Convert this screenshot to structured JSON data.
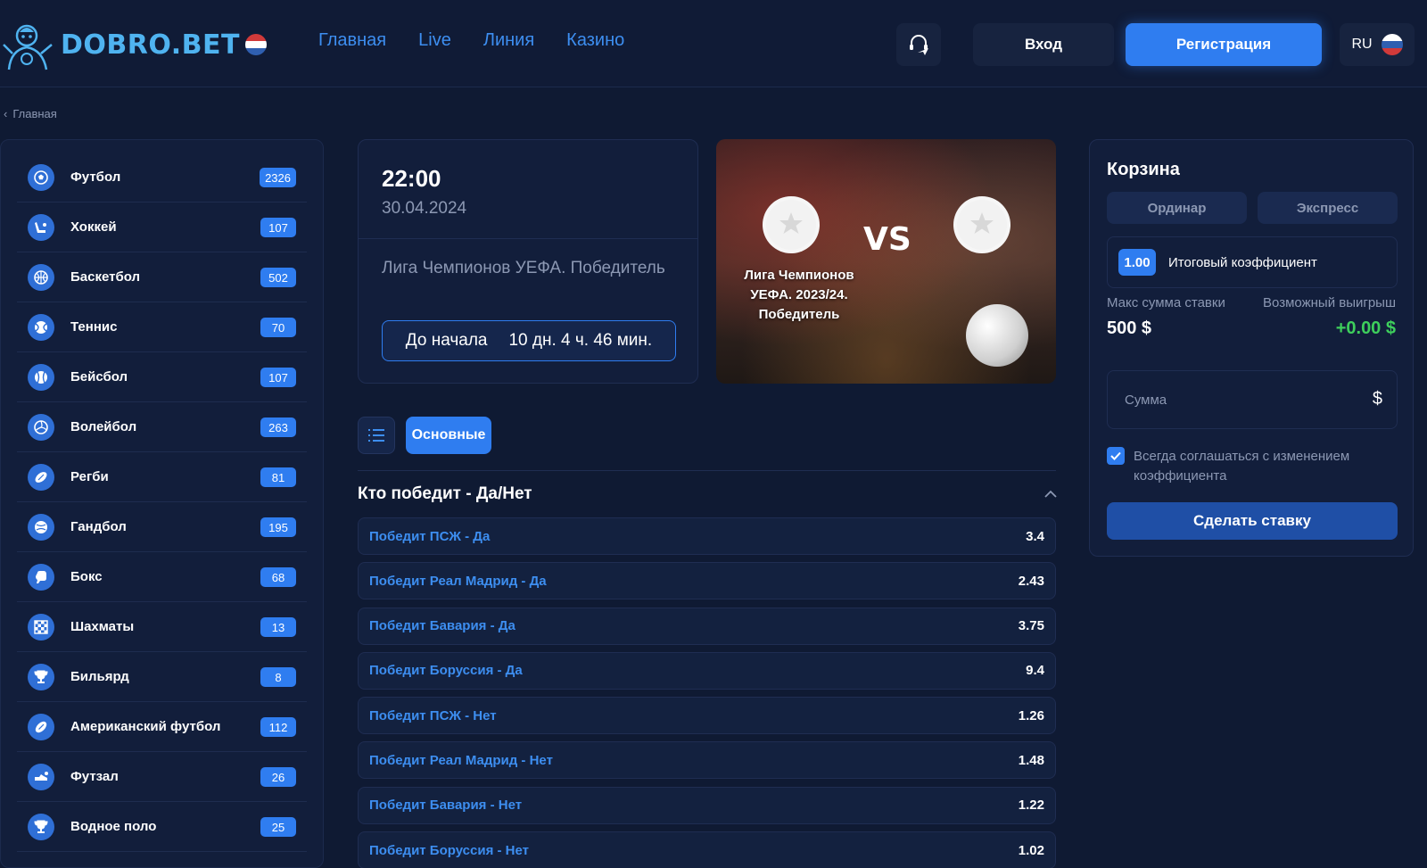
{
  "brand": {
    "name": "DOBRO.BET"
  },
  "nav": [
    "Главная",
    "Live",
    "Линия",
    "Казино"
  ],
  "header": {
    "login_label": "Вход",
    "register_label": "Регистрация",
    "lang": "RU"
  },
  "breadcrumb": {
    "back_label": "Главная"
  },
  "sports": [
    {
      "name": "Футбол",
      "count": "2326",
      "icon": "soccer-ball-icon"
    },
    {
      "name": "Хоккей",
      "count": "107",
      "icon": "hockey-icon"
    },
    {
      "name": "Баскетбол",
      "count": "502",
      "icon": "basketball-icon"
    },
    {
      "name": "Теннис",
      "count": "70",
      "icon": "tennis-ball-icon"
    },
    {
      "name": "Бейсбол",
      "count": "107",
      "icon": "baseball-icon"
    },
    {
      "name": "Волейбол",
      "count": "263",
      "icon": "volleyball-icon"
    },
    {
      "name": "Регби",
      "count": "81",
      "icon": "rugby-ball-icon"
    },
    {
      "name": "Гандбол",
      "count": "195",
      "icon": "handball-icon"
    },
    {
      "name": "Бокс",
      "count": "68",
      "icon": "boxing-glove-icon"
    },
    {
      "name": "Шахматы",
      "count": "13",
      "icon": "chess-board-icon"
    },
    {
      "name": "Бильярд",
      "count": "8",
      "icon": "trophy-icon"
    },
    {
      "name": "Американский футбол",
      "count": "112",
      "icon": "american-football-icon"
    },
    {
      "name": "Футзал",
      "count": "26",
      "icon": "futsal-shoe-icon"
    },
    {
      "name": "Водное поло",
      "count": "25",
      "icon": "trophy-icon"
    }
  ],
  "match": {
    "time": "22:00",
    "date": "30.04.2024",
    "league": "Лига Чемпионов УЕФА. Победитель",
    "countdown_label": "До начала",
    "countdown_value": "10 дн. 4 ч. 46 мин."
  },
  "banner": {
    "vs": "VS",
    "title": "Лига Чемпионов УЕФА. 2023/24. Победитель"
  },
  "markets": {
    "tab_main": "Основные",
    "title": "Кто победит - Да/Нет",
    "odds": [
      {
        "label": "Победит ПСЖ - Да",
        "value": "3.4"
      },
      {
        "label": "Победит Реал Мадрид - Да",
        "value": "2.43"
      },
      {
        "label": "Победит Бавария - Да",
        "value": "3.75"
      },
      {
        "label": "Победит Боруссия - Да",
        "value": "9.4"
      },
      {
        "label": "Победит ПСЖ - Нет",
        "value": "1.26"
      },
      {
        "label": "Победит Реал Мадрид - Нет",
        "value": "1.48"
      },
      {
        "label": "Победит Бавария - Нет",
        "value": "1.22"
      },
      {
        "label": "Победит Боруссия - Нет",
        "value": "1.02"
      }
    ]
  },
  "betslip": {
    "title": "Корзина",
    "tab_single": "Ординар",
    "tab_express": "Экспресс",
    "coef": "1.00",
    "coef_label": "Итоговый коэффициент",
    "max_label": "Макс сумма ставки",
    "max_value": "500 $",
    "win_label": "Возможный выигрыш",
    "win_value": "+0.00 $",
    "amount_placeholder": "Сумма",
    "currency": "$",
    "agree_label": "Всегда соглашаться с изменением коэффициента",
    "submit_label": "Сделать ставку"
  },
  "colors": {
    "accent": "#2f7df0",
    "background": "#0f1a33",
    "panel": "#121e3b",
    "link": "#3d8ef0",
    "positive": "#3ecf5c"
  }
}
